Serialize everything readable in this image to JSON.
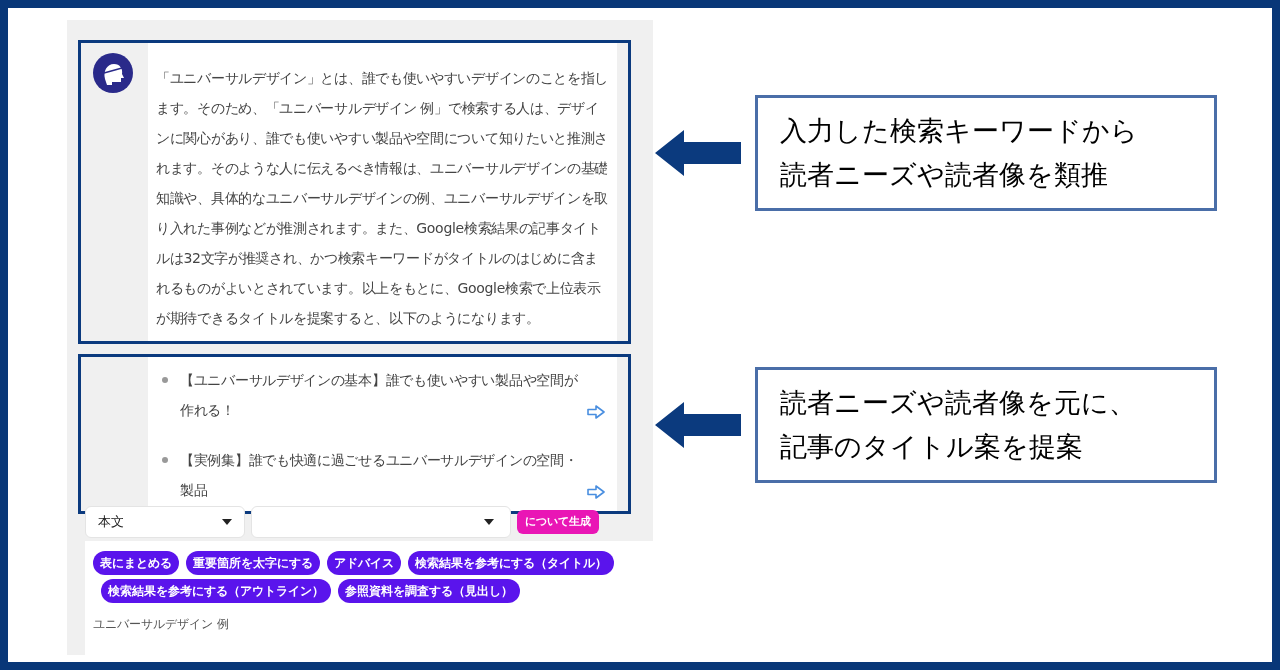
{
  "message": {
    "paragraph": "「ユニバーサルデザイン」とは、誰でも使いやすいデザインのことを指します。そのため、「ユニバーサルデザイン 例」で検索する人は、デザインに関心があり、誰でも使いやすい製品や空間について知りたいと推測されます。そのような人に伝えるべき情報は、ユニバーサルデザインの基礎知識や、具体的なユニバーサルデザインの例、ユニバーサルデザインを取り入れた事例などが推測されます。また、Google検索結果の記事タイトルは32文字が推奨され、かつ検索キーワードがタイトルのはじめに含まれるものがよいとされています。以上をもとに、Google検索で上位表示が期待できるタイトルを提案すると、以下のようになります。",
    "suggestions": [
      {
        "lines": [
          "【ユニバーサルデザインの基本】誰でも使いやすい製品や空間が",
          "作れる！"
        ]
      },
      {
        "lines": [
          "【実例集】誰でも快適に過ごせるユニバーサルデザインの空間・",
          "製品"
        ]
      }
    ]
  },
  "toolbar": {
    "style_select": "本文",
    "generate_button": "について生成"
  },
  "chips": [
    {
      "label": "表にまとめる"
    },
    {
      "label": "重要箇所を太字にする"
    },
    {
      "label": "アドバイス"
    },
    {
      "label": "検索結果を参考にする（タイトル）"
    },
    {
      "label": "検索結果を参考にする（アウトライン）"
    },
    {
      "label": "参照資料を調査する（見出し）"
    }
  ],
  "input": {
    "value": "ユニバーサルデザイン 例"
  },
  "callouts": [
    {
      "lines": [
        "入力した検索キーワードから",
        "読者ニーズや読者像を類推"
      ]
    },
    {
      "lines": [
        "読者ニーズや読者像を元に、",
        "記事のタイトル案を提案"
      ]
    }
  ]
}
